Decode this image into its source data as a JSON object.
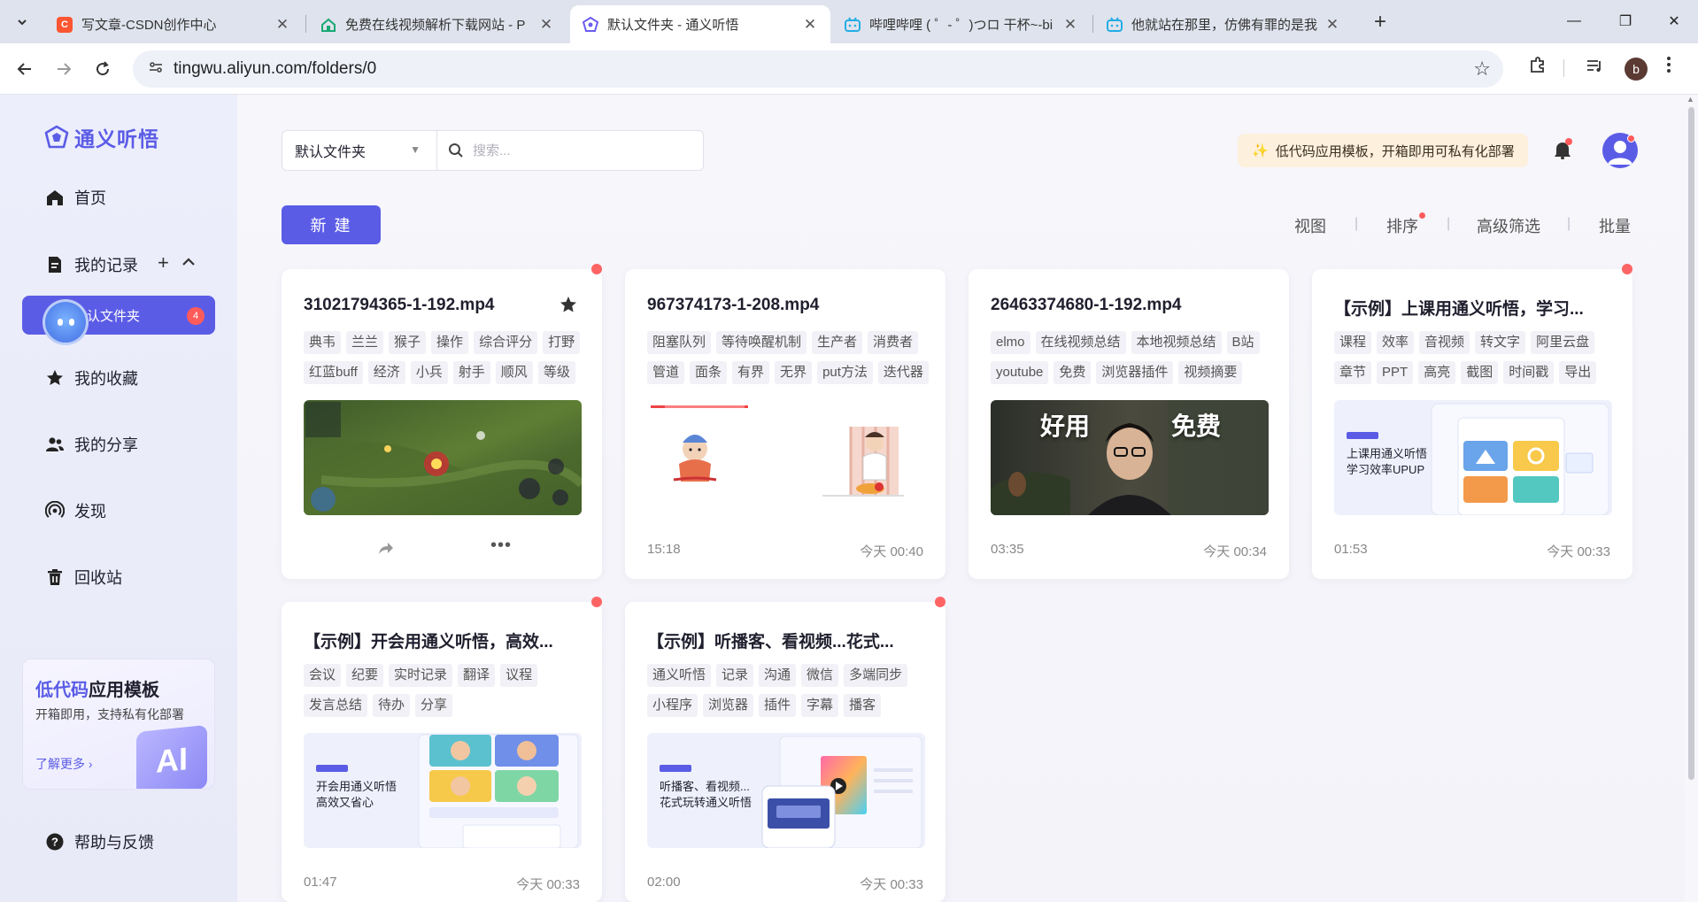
{
  "browser": {
    "tabs": [
      {
        "title": "写文章-CSDN创作中心",
        "favicon_color": "#fc5531",
        "favicon_text": "C"
      },
      {
        "title": "免费在线视频解析下载网站 - P",
        "favicon_color": "#19a974",
        "favicon_text": ""
      },
      {
        "title": "默认文件夹 - 通义听悟",
        "favicon_color": "#6b5cf0",
        "favicon_text": ""
      },
      {
        "title": "哔哩哔哩 ( ゜- ゜)つロ 干杯~-bi",
        "favicon_color": "#23ade5",
        "favicon_text": ""
      },
      {
        "title": "他就站在那里，仿佛有罪的是我",
        "favicon_color": "#23ade5",
        "favicon_text": ""
      }
    ],
    "url": "tingwu.aliyun.com/folders/0",
    "profile_initial": "b"
  },
  "app": {
    "logo_text": "通义听悟",
    "nav": {
      "home": "首页",
      "records": "我的记录",
      "favorites": "我的收藏",
      "shares": "我的分享",
      "discover": "发现",
      "trash": "回收站",
      "help": "帮助与反馈"
    },
    "folder_item": {
      "label": "默认文件夹",
      "badge": "4"
    },
    "promo": {
      "title_highlight": "低代码",
      "title_rest": "应用模板",
      "subtitle": "开箱即用，支持私有化部署",
      "link": "了解更多 ›",
      "ai_text": "AI"
    }
  },
  "toolbar": {
    "folder_select": "默认文件夹",
    "search_placeholder": "搜索...",
    "new_button": "新 建",
    "banner": "低代码应用模板，开箱即用可私有化部署",
    "view": "视图",
    "sort": "排序",
    "filter": "高级筛选",
    "batch": "批量"
  },
  "cards": [
    {
      "title": "31021794365-1-192.mp4",
      "tags": [
        "典韦",
        "兰兰",
        "猴子",
        "操作",
        "综合评分",
        "打野",
        "红蓝buff",
        "经济",
        "小兵",
        "射手",
        "顺风",
        "等级"
      ],
      "thumb": "game",
      "duration": "",
      "time": "",
      "hover": true,
      "dot": true,
      "starred": true
    },
    {
      "title": "967374173-1-208.mp4",
      "tags": [
        "阻塞队列",
        "等待唤醒机制",
        "生产者",
        "消费者",
        "管道",
        "面条",
        "有界",
        "无界",
        "put方法",
        "迭代器"
      ],
      "thumb": "cartoon",
      "duration": "15:18",
      "time": "今天 00:40",
      "hover": false,
      "dot": false,
      "starred": false
    },
    {
      "title": "26463374680-1-192.mp4",
      "tags": [
        "elmo",
        "在线视频总结",
        "本地视频总结",
        "B站",
        "youtube",
        "免费",
        "浏览器插件",
        "视频摘要"
      ],
      "thumb": "person",
      "thumb_text_left": "好用",
      "thumb_text_right": "免费",
      "duration": "03:35",
      "time": "今天 00:34",
      "hover": false,
      "dot": false,
      "starred": false
    },
    {
      "title": "【示例】上课用通义听悟，学习...",
      "tags": [
        "课程",
        "效率",
        "音视频",
        "转文字",
        "阿里云盘",
        "章节",
        "PPT",
        "高亮",
        "截图",
        "时间戳",
        "导出"
      ],
      "thumb": "class",
      "thumb_text": "上课用通义听悟\n学习效率UPUP",
      "duration": "01:53",
      "time": "今天 00:33",
      "hover": false,
      "dot": true,
      "starred": false
    },
    {
      "title": "【示例】开会用通义听悟，高效...",
      "tags": [
        "会议",
        "纪要",
        "实时记录",
        "翻译",
        "议程",
        "发言总结",
        "待办",
        "分享"
      ],
      "thumb": "meeting",
      "thumb_text": "开会用通义听悟\n高效又省心",
      "duration": "01:47",
      "time": "今天 00:33",
      "hover": false,
      "dot": true,
      "starred": false
    },
    {
      "title": "【示例】听播客、看视频...花式...",
      "tags": [
        "通义听悟",
        "记录",
        "沟通",
        "微信",
        "多端同步",
        "小程序",
        "浏览器",
        "插件",
        "字幕",
        "播客"
      ],
      "thumb": "podcast",
      "thumb_text": "听播客、看视频...\n花式玩转通义听悟",
      "duration": "02:00",
      "time": "今天 00:33",
      "hover": false,
      "dot": true,
      "starred": false
    }
  ],
  "colors": {
    "accent": "#5b5ce6",
    "badge_red": "#ff5b5b",
    "banner_bg": "#fdf0dc"
  }
}
